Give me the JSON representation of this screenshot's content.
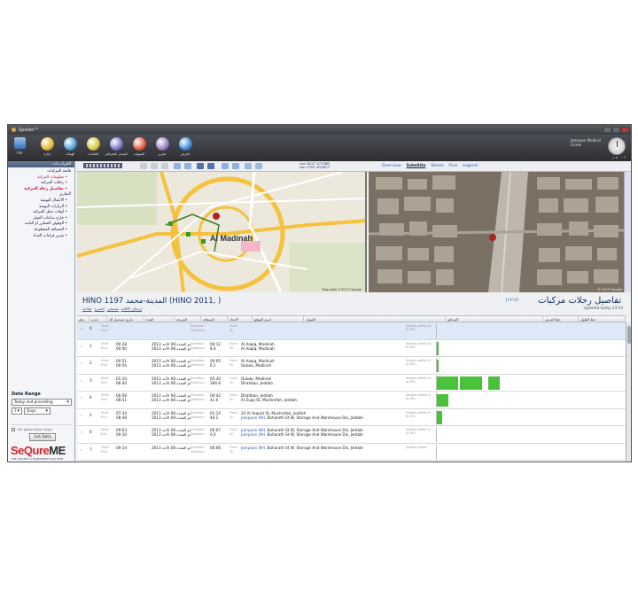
{
  "app": {
    "title": "Spoton™",
    "file_label": "File"
  },
  "ribbon": {
    "items": [
      {
        "label": "إدارة",
        "icon": "gold-orb-icon",
        "color": "#e9b52d"
      },
      {
        "label": "الهيئات",
        "icon": "chart-icon",
        "color": "#4a9ad6"
      },
      {
        "label": "العلامات",
        "icon": "color-wheel-icon",
        "color": "#d8c63b"
      },
      {
        "label": "المسار الجغرافي",
        "icon": "target-icon",
        "color": "#7c74c9"
      },
      {
        "label": "التنبيهات",
        "icon": "alarm-clock-icon",
        "color": "#e35b3b"
      },
      {
        "label": "تقارير",
        "icon": "person-report-icon",
        "color": "#9a7cc1"
      },
      {
        "label": "العرض",
        "icon": "globe-icon",
        "color": "#3d86d6"
      }
    ],
    "user_name": "Jampoon Medical",
    "user_sub": "Grade",
    "clock_caption": "٠٣ : ٥٠ م"
  },
  "nav": {
    "header": "الحركــــات",
    "items": [
      {
        "label": "قائمة المركبات",
        "type": "item"
      },
      {
        "label": "معلومات المركبة •",
        "type": "sub"
      },
      {
        "label": "رحلات المركبة •",
        "type": "sub alt"
      },
      {
        "label": "تفاصيل رحلة المركبة •",
        "type": "sub bold"
      },
      {
        "label": "التقارير",
        "type": "item"
      },
      {
        "label": "الأعمال اليومية •",
        "type": "sub alt"
      },
      {
        "label": "الزيارات اليومية •",
        "type": "sub alt"
      },
      {
        "label": "أوقات عمل المركبة •",
        "type": "sub alt"
      },
      {
        "label": "خارج ساعات العمل •",
        "type": "sub alt"
      },
      {
        "label": "الوقوف المتكرر أو الثابت •",
        "type": "sub alt"
      },
      {
        "label": "المسافة المقطوعة •",
        "type": "sub alt"
      },
      {
        "label": "تقرير قراءات العداد •",
        "type": "sub alt"
      }
    ],
    "date_range_label": "Date Range",
    "range_select": "Today and preceding",
    "days_value": "7",
    "days_unit": "Days",
    "use_global": "Use global date range",
    "get_data": "Get Data",
    "logo_main": "SeQure",
    "logo_me": "ME",
    "logo_tag": "FIRE, SECURITY & MANAGEMENT SOLUTIONS"
  },
  "map": {
    "coords_line1": "Lat: N24° 471368",
    "coords_line2": "Lon: E39° 874877",
    "view_links": [
      "Overview",
      "Satellite",
      "Street",
      "Find",
      "Legend"
    ],
    "active_view": "Satellite",
    "city_label": "Al Madinah",
    "map_credit": "Map data ©2013 Google",
    "sat_credit": "© 2013 Google"
  },
  "trips": {
    "vehicle": "HINO 1197 المدينة-محمد (HINO 2011, )",
    "title": "تفاصيل رحلات مركبات",
    "count": "(۱۷۱۷)",
    "updated": "Updated today 23:54",
    "actions": [
      "طباعة",
      "الشرح",
      "تفصيلي",
      "إرسال الأقلام"
    ],
    "columns": [
      "رقم",
      "حدث",
      "تـاريخ تسـجيل أقـ",
      "المدة",
      "السرعة",
      "المسافة",
      "الاتجاه",
      "اسـم الموقع",
      "العنوان",
      "السـائق",
      "خط العرض",
      "خط الطول"
    ],
    "rows": [
      {
        "n": "0",
        "start_time": "",
        "end_time": "",
        "date1": "",
        "date2": "",
        "duration": "",
        "distance": "",
        "from": "",
        "to": "",
        "speed": "Speed profile (0 to 90)",
        "selected": true,
        "bars": []
      },
      {
        "n": "1",
        "start_time": "00:28",
        "end_time": "00:40",
        "date1": "2013 ذو القعدة 08 الأحد",
        "date2": "2013 ذو القعدة 08 الأحد",
        "duration": "00:12",
        "distance": "8.4",
        "from": "Al Aaqiq, Madinah",
        "to": "Al Aaqiq, Madinah",
        "speed": "Speed profile (0 to 90)",
        "selected": false,
        "bars": [
          {
            "start": 0.0,
            "end": 0.01,
            "level": 0.95
          }
        ]
      },
      {
        "n": "2",
        "start_time": "00:51",
        "end_time": "00:56",
        "date1": "2013 ذو القعدة 08 الأحد",
        "date2": "2013 ذو القعدة 08 الأحد",
        "duration": "00:05",
        "distance": "6.1",
        "from": "Al Aaqiq, Madinah",
        "to": "Qubaa, Madinah",
        "speed": "Speed profile (0 to 90)",
        "selected": false,
        "bars": [
          {
            "start": 0.0,
            "end": 0.01,
            "level": 0.95
          }
        ]
      },
      {
        "n": "3",
        "start_time": "01:10",
        "end_time": "06:40",
        "date1": "2013 ذو القعدة 08 الأحد",
        "date2": "2013 ذو القعدة 08 الأحد",
        "duration": "05:30",
        "distance": "366.6",
        "from": "Qubaa, Madinah",
        "to": "Dhahban, Jeddah",
        "speed": "Speed profile (0 to 90)",
        "selected": false,
        "bars": [
          {
            "start": 0.0,
            "end": 0.11,
            "level": 0.95
          },
          {
            "start": 0.12,
            "end": 0.24,
            "level": 0.95
          },
          {
            "start": 0.27,
            "end": 0.33,
            "level": 0.95
          }
        ]
      },
      {
        "n": "4",
        "start_time": "06:08",
        "end_time": "08:51",
        "date1": "2013 ذو القعدة 08 الأحد",
        "date2": "2013 ذو القعدة 08 الأحد",
        "duration": "00:42",
        "distance": "42.0",
        "from": "Dhahban, Jeddah",
        "to": "Al Zujaj St, Mushrefah, Jeddah",
        "speed": "Speed profile (0 to 90)",
        "selected": false,
        "bars": [
          {
            "start": 0.0,
            "end": 0.06,
            "level": 0.95
          }
        ]
      },
      {
        "n": "5",
        "start_time": "07:34",
        "end_time": "08:48",
        "date1": "2013 ذو القعدة 08 الأحد",
        "date2": "2013 ذو القعدة 08 الأحد",
        "duration": "01:14",
        "distance": "46.1",
        "from": "24 Al Yaqout St, Mushrefah, Jeddah",
        "from_link": "",
        "to": "Bahareth St W, Storage And Warehouse Dis, Jeddah",
        "to_link": "Jampoon WH.",
        "speed": "Speed profile (0 to 90)",
        "selected": false,
        "bars": [
          {
            "start": 0.0,
            "end": 0.03,
            "level": 0.95
          }
        ]
      },
      {
        "n": "6",
        "start_time": "09:03",
        "end_time": "09:10",
        "date1": "2013 ذو القعدة 08 الأحد",
        "date2": "2013 ذو القعدة 08 الأحد",
        "duration": "00:07",
        "distance": "0.0",
        "from": "Baharath St W, Storage And Warehouse Dis, Jeddah",
        "from_link": "Jampoon WH.",
        "to": "Baharath St W, Storage And Warehouse Dis, Jeddah",
        "to_link": "Jampoon WH.",
        "speed": "Speed profile (0 to 90)",
        "selected": false,
        "bars": []
      },
      {
        "n": "7",
        "start_time": "09:14",
        "end_time": "",
        "date1": "2013 ذو القعدة 08 الأحد",
        "date2": "",
        "duration": "00:06",
        "distance": "",
        "from": "Baharath St W, Storage And Warehouse Dis, Jeddah",
        "from_link": "Jampoon WH.",
        "to": "",
        "speed": "Speed profile",
        "selected": false,
        "bars": []
      }
    ],
    "labels": {
      "start": "Start",
      "end": "End",
      "duration": "Duration",
      "distance": "Distance",
      "from": "From",
      "to": "To"
    }
  },
  "colors": {
    "accent_green": "#49c13a",
    "link": "#2a5db0",
    "title_blue": "#16305c",
    "logo_red": "#d8232a"
  }
}
